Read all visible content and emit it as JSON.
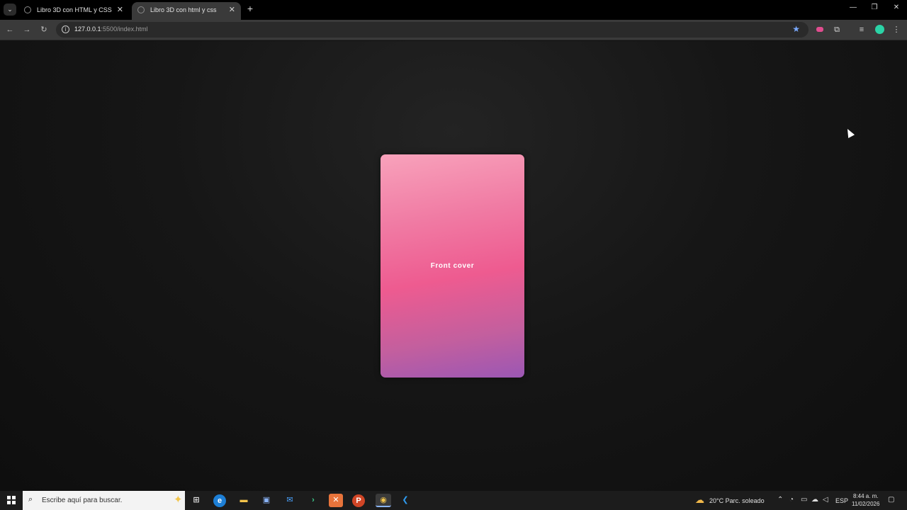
{
  "browser": {
    "tabs": [
      {
        "title": "Libro 3D con HTML y CSS",
        "active": false
      },
      {
        "title": "Libro 3D con html y css",
        "active": true
      }
    ],
    "url_host": "127.0.0.1",
    "url_rest": ":5500/index.html"
  },
  "page": {
    "book_title": "Front cover",
    "book_gradient": [
      "#f8a2bb",
      "#ee5b90",
      "#9b57b4"
    ]
  },
  "taskbar": {
    "search_placeholder": "Escribe aquí para buscar.",
    "weather": "20°C  Parc. soleado",
    "language": "ESP",
    "time": "8:44 a. m.",
    "date": "11/02/2026"
  }
}
